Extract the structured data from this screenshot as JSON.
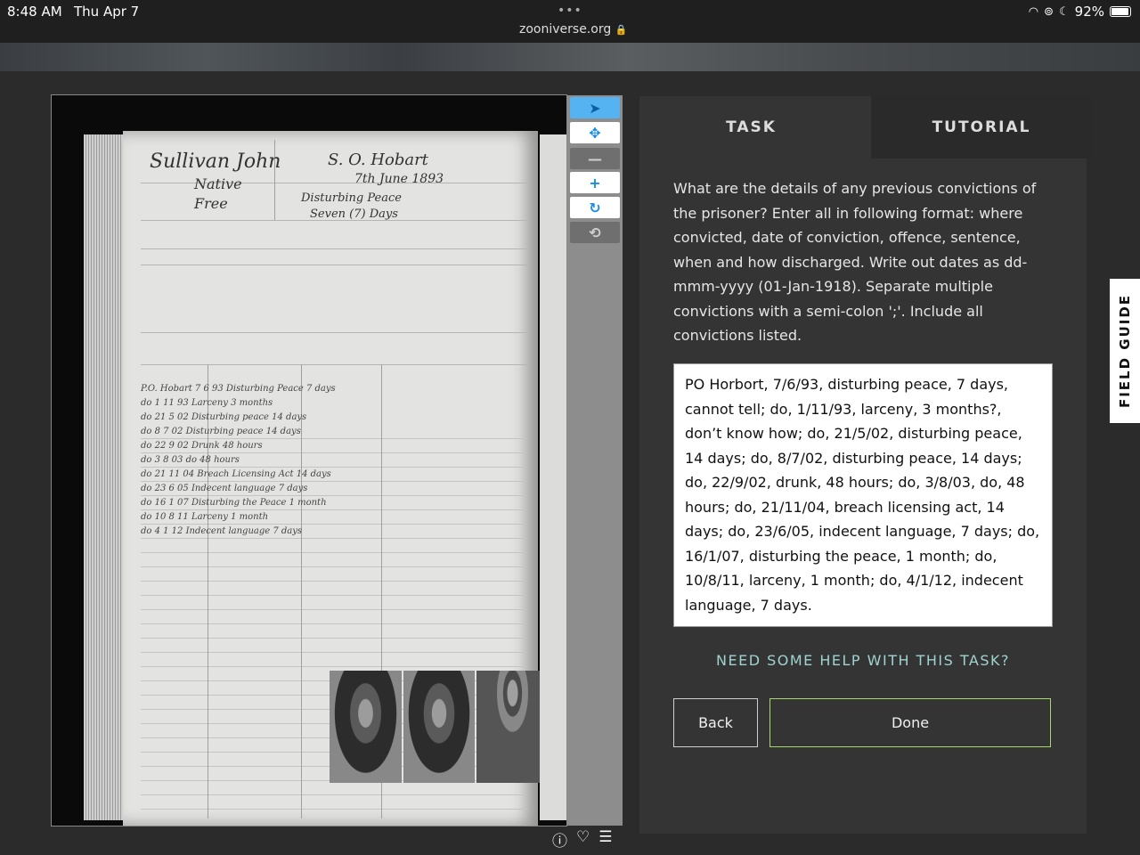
{
  "status_bar": {
    "time": "8:48 AM",
    "date": "Thu Apr 7",
    "url": "zooniverse.org",
    "battery": "92%"
  },
  "viewer": {
    "document_text": {
      "name": "Sullivan John",
      "ship": "S. O. Hobart",
      "date": "7th June 1893",
      "native": "Native",
      "free": "Free",
      "offence": "Disturbing Peace",
      "sentence": "Seven (7) Days",
      "rows": [
        "P.O. Hobart  7 6 93  Disturbing Peace  7 days",
        "do  1 11 93  Larceny  3 months",
        "do  21 5 02  Disturbing peace 14 days",
        "do  8 7 02  Disturbing peace 14 days",
        "do  22 9 02  Drunk  48 hours",
        "do  3 8 03  do  48 hours",
        "do  21 11 04  Breach Licensing Act 14 days",
        "do  23 6 05  Indecent language 7 days",
        "do  16 1 07  Disturbing the Peace 1 month",
        "do  10 8 11  Larceny  1 month",
        "do  4 1 12  Indecent language 7 days"
      ]
    },
    "tools": [
      {
        "name": "pointer-icon",
        "glyph": "➤",
        "state": "active"
      },
      {
        "name": "move-icon",
        "glyph": "✥",
        "state": "normal"
      },
      {
        "name": "zoom-out-icon",
        "glyph": "—",
        "state": "disabled"
      },
      {
        "name": "zoom-in-icon",
        "glyph": "+",
        "state": "normal"
      },
      {
        "name": "rotate-icon",
        "glyph": "↻",
        "state": "normal"
      },
      {
        "name": "reset-icon",
        "glyph": "⟲",
        "state": "disabled"
      }
    ]
  },
  "panel": {
    "tab_task": "TASK",
    "tab_tutorial": "TUTORIAL",
    "question": "What are the details of any previous convictions of the prisoner? Enter all in following format: where convicted, date of conviction, offence, sentence, when and how discharged. Write out dates as dd-mmm-yyyy (01-Jan-1918). Separate multiple convictions with a semi-colon ';'. Include all convictions listed.",
    "answer": "PO Horbort, 7/6/93, disturbing peace, 7 days, cannot tell; do, 1/11/93, larceny, 3 months?, don’t know how; do, 21/5/02, disturbing peace, 14 days; do, 8/7/02, disturbing peace, 14 days; do, 22/9/02, drunk, 48 hours; do, 3/8/03, do, 48 hours; do, 21/11/04, breach licensing act, 14 days; do, 23/6/05, indecent language, 7 days; do, 16/1/07, disturbing the peace, 1 month; do, 10/8/11, larceny, 1 month; do, 4/1/12, indecent language, 7 days.",
    "help_link": "NEED SOME HELP WITH THIS TASK?",
    "back_label": "Back",
    "done_label": "Done"
  },
  "field_guide_label": "FIELD GUIDE",
  "colors": {
    "done_border": "#a6d96a",
    "help_link": "#9ed3d0",
    "tool_accent": "#1a8fe0"
  }
}
